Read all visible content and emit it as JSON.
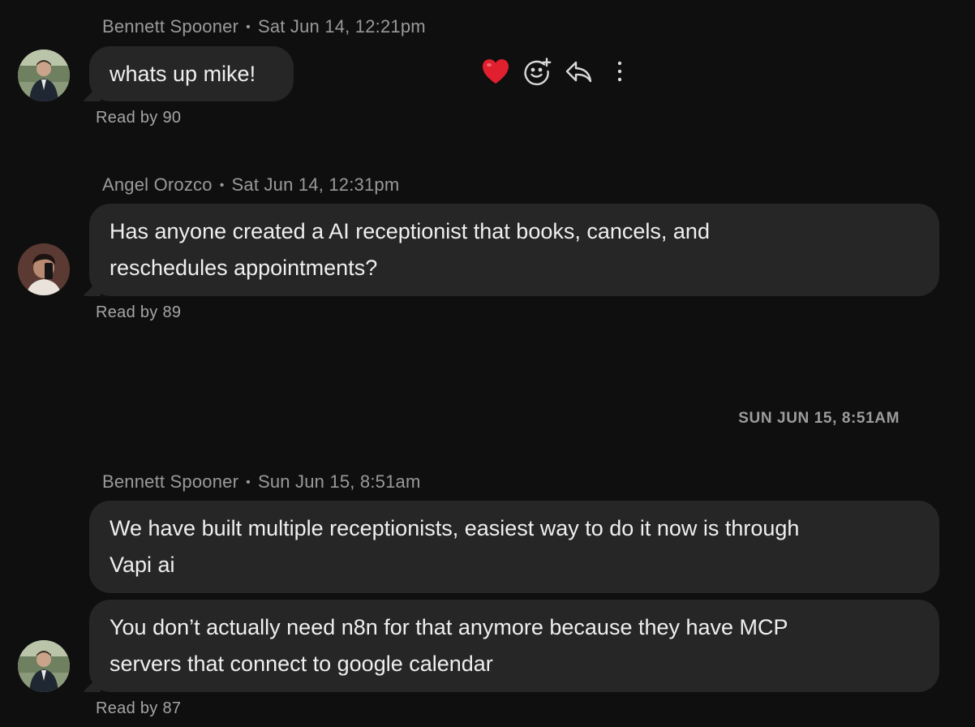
{
  "messages": [
    {
      "author": "Bennett Spooner",
      "timestamp": "Sat Jun 14, 12:21pm",
      "lines": [
        "whats up mike!"
      ],
      "read": "Read by 90"
    },
    {
      "author": "Angel Orozco",
      "timestamp": "Sat Jun 14, 12:31pm",
      "lines": [
        "Has anyone created a AI receptionist that books, cancels, and",
        "reschedules appointments?"
      ],
      "read": "Read by 89"
    },
    {
      "author": "Bennett Spooner",
      "timestamp": "Sun Jun 15, 8:51am",
      "lines": [
        "We have built multiple receptionists, easiest way to do it now is through",
        "Vapi ai"
      ],
      "read": ""
    },
    {
      "author": "",
      "timestamp": "",
      "lines": [
        "You don’t actually need n8n for that anymore because they have MCP",
        "servers that connect to google calendar"
      ],
      "read": "Read by 87"
    }
  ],
  "separator": "•",
  "day_divider": "SUN JUN 15, 8:51AM",
  "hover_actions": [
    {
      "icon": "heart-icon",
      "glyph": "❤️"
    },
    {
      "icon": "add-reaction-icon"
    },
    {
      "icon": "reply-icon"
    },
    {
      "icon": "more-options-icon"
    }
  ],
  "colors": {
    "background": "#0f0f0f",
    "bubble": "#262626",
    "meta_text": "#9a9a9a",
    "heart": "#e0202e"
  }
}
